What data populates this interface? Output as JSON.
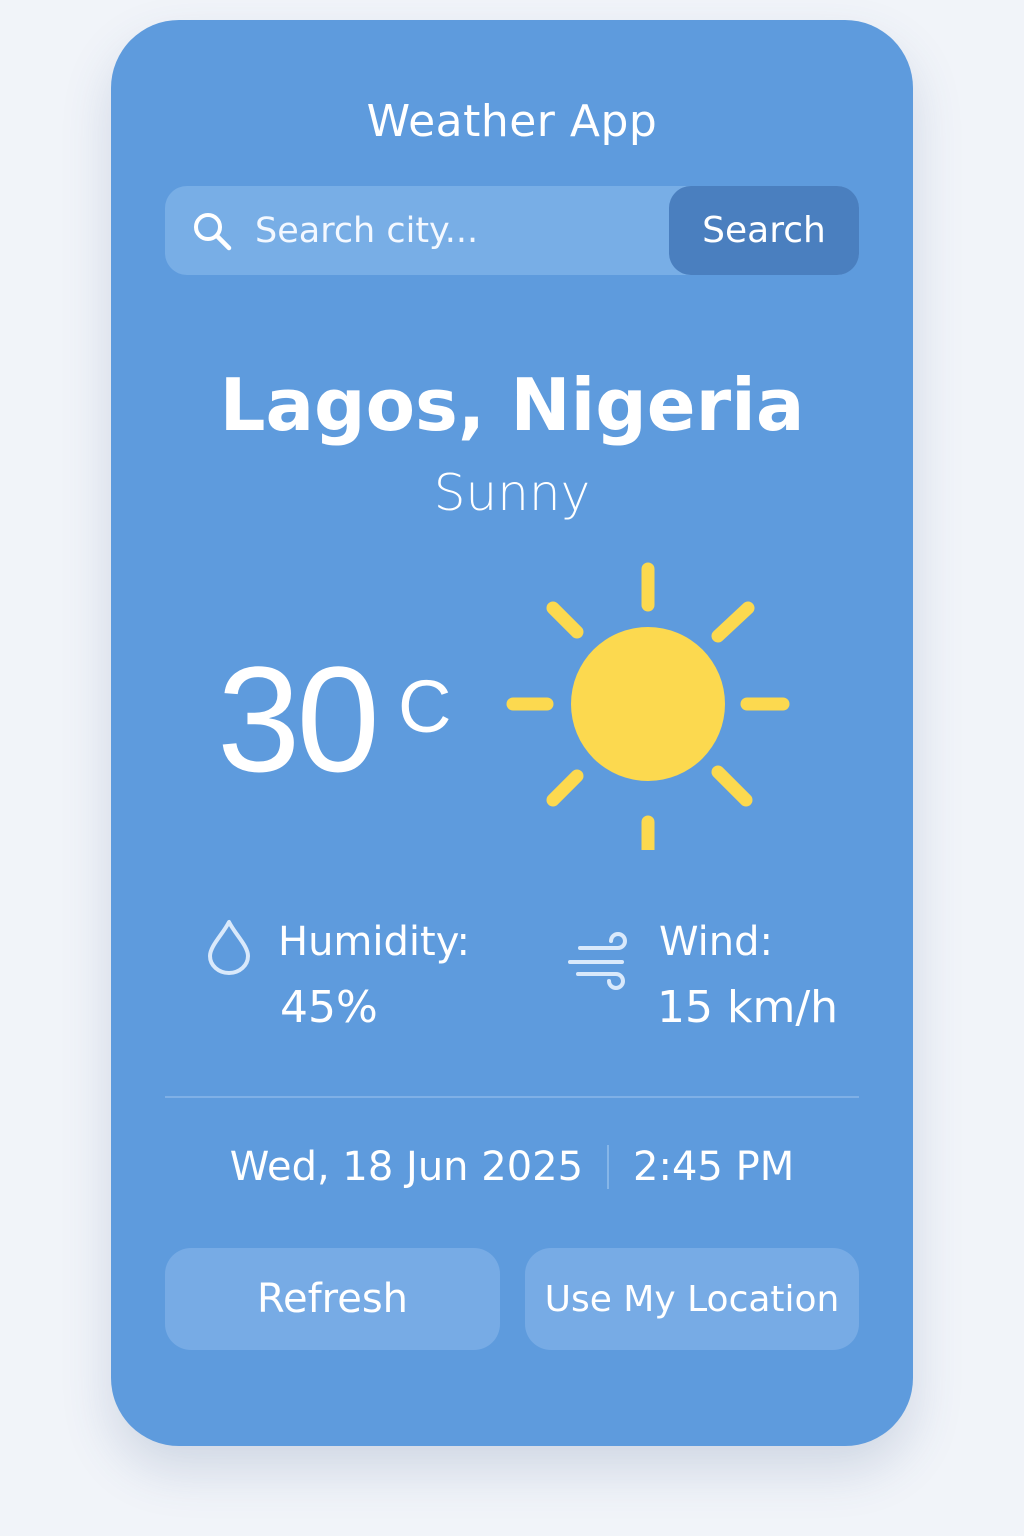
{
  "app": {
    "title": "Weather App"
  },
  "search": {
    "placeholder": "Search city...",
    "value": "",
    "button_label": "Search",
    "icon": "search-icon"
  },
  "weather": {
    "city": "Lagos, Nigeria",
    "condition": "Sunny",
    "temperature": "30",
    "unit": "C",
    "condition_icon": "sun-icon"
  },
  "stats": {
    "humidity": {
      "label": "Humidity:",
      "value": "45%",
      "icon": "droplet-icon"
    },
    "wind": {
      "label": "Wind:",
      "value": "15 km/h",
      "icon": "wind-icon"
    }
  },
  "datetime": {
    "date": "Wed, 18 Jun 2025",
    "time": "2:45 PM"
  },
  "actions": {
    "refresh_label": "Refresh",
    "location_label": "Use My Location"
  },
  "colors": {
    "page_background": "#f1f4f9",
    "card_background": "#5e9bdd",
    "search_bar": "#78aee6",
    "search_button": "#4a7fbf",
    "action_button": "#77abe5",
    "sun": "#fcd94f",
    "text": "#ffffff"
  }
}
